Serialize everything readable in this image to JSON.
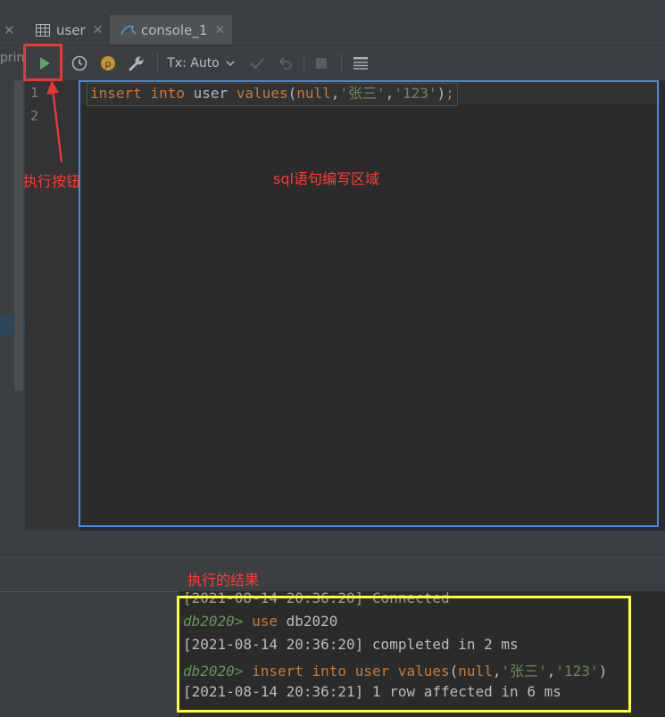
{
  "tabs": [
    {
      "label": "user",
      "icon": "table-icon"
    },
    {
      "label": "console_1",
      "icon": "mysql-icon",
      "active": true
    }
  ],
  "left_panel_cut_text": "prin",
  "toolbar": {
    "tx_mode": "Tx: Auto"
  },
  "editor": {
    "line_numbers": [
      "1",
      "2"
    ],
    "code_tokens": {
      "kw_insert": "insert",
      "kw_into": "into",
      "plain_table": "user",
      "kw_values": "values",
      "paren_open": "(",
      "kw_null": "null",
      "comma1": ",",
      "str_name": "'张三'",
      "comma2": ",",
      "str_pwd": "'123'",
      "paren_close": ")",
      "semicolon": ";"
    }
  },
  "output": {
    "line1": "[2021-08-14 20:36:20] Connected",
    "prompt1": "db2020>",
    "cmd1_kw": "use",
    "cmd1_rest": "db2020",
    "line3": "[2021-08-14 20:36:20] completed in 2 ms",
    "prompt2": "db2020>",
    "cmd2_insert": "insert",
    "cmd2_into": "into",
    "cmd2_table": "user",
    "cmd2_values": "values",
    "cmd2_paren_open": "(",
    "cmd2_null": "null",
    "cmd2_comma1": ",",
    "cmd2_name": "'张三'",
    "cmd2_comma2": ",",
    "cmd2_pwd": "'123'",
    "cmd2_paren_close": ")",
    "line5": "[2021-08-14 20:36:21] 1 row affected in 6 ms"
  },
  "annotations": {
    "run_button": "执行按钮",
    "editor_area": "sql语句编写区域",
    "result": "执行的结果"
  },
  "colors": {
    "keyword": "#cc7832",
    "string": "#6a8759",
    "prompt": "#629755",
    "annotation_red": "#ff3b30",
    "editor_box_blue": "#3d8ee6",
    "result_box_yellow": "#ffff3c",
    "run_green": "#59a869"
  }
}
